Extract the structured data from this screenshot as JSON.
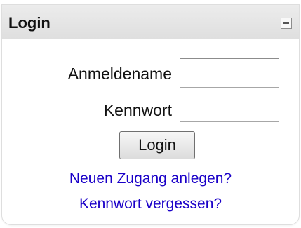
{
  "block": {
    "title": "Login",
    "collapse_icon": "minus-box-icon"
  },
  "form": {
    "username_label": "Anmeldename",
    "username_value": "",
    "password_label": "Kennwort",
    "password_value": "",
    "submit_label": "Login"
  },
  "links": {
    "register": "Neuen Zugang anlegen?",
    "forgot_password": "Kennwort vergessen?"
  },
  "colors": {
    "link": "#1a00c8",
    "header_bg": "#e5e5e5"
  }
}
